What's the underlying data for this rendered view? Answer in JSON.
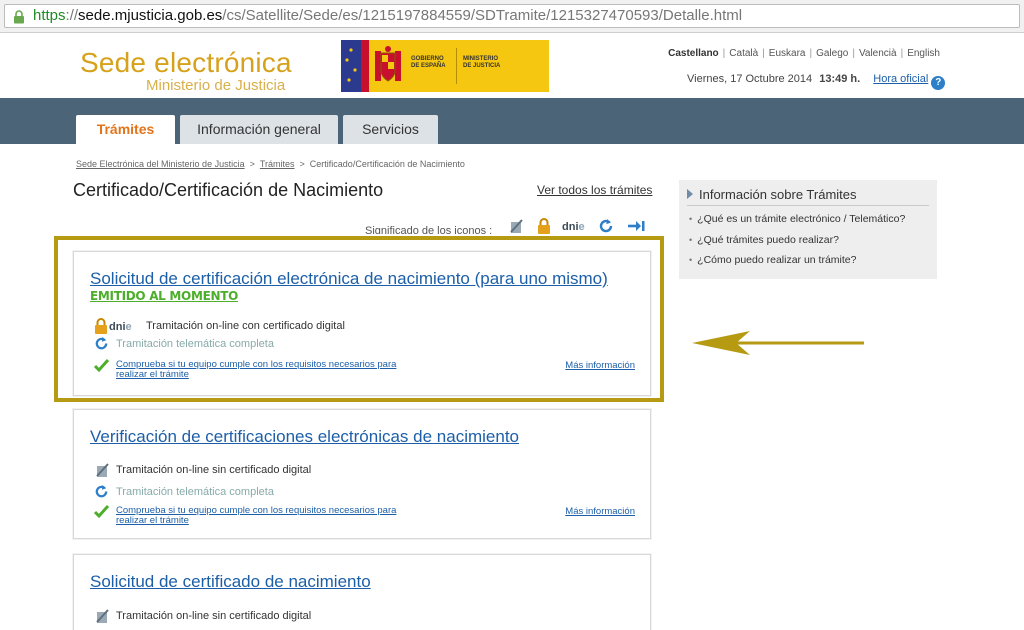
{
  "browser": {
    "url_scheme": "https",
    "url_sep": "://",
    "url_host": "sede.mjusticia.gob.es",
    "url_path": "/cs/Satellite/Sede/es/1215197884559/SDTramite/1215327470593/Detalle.html"
  },
  "header": {
    "brand_title": "Sede electrónica",
    "brand_subtitle": "Ministerio de Justicia",
    "gov_logo_text1": "GOBIERNO\nDE ESPAÑA",
    "gov_logo_text2": "MINISTERIO\nDE JUSTICIA",
    "languages": [
      "Castellano",
      "Català",
      "Euskara",
      "Galego",
      "Valencià",
      "English"
    ],
    "date": "Viernes, 17 Octubre 2014",
    "time": "13:49 h.",
    "hora_oficial": "Hora oficial",
    "help": "?"
  },
  "nav": {
    "tabs": [
      {
        "label": "Trámites"
      },
      {
        "label": "Información general"
      },
      {
        "label": "Servicios"
      }
    ]
  },
  "breadcrumb": {
    "items": [
      "Sede Electrónica del Ministerio de Justicia",
      "Trámites",
      "Certificado/Certificación de Nacimiento"
    ],
    "sep": ">"
  },
  "main": {
    "title": "Certificado/Certificación de Nacimiento",
    "see_all": "Ver todos los trámites",
    "icons_legend": "Significado de los iconos :",
    "cards": [
      {
        "title": "Solicitud de certificación electrónica de nacimiento (para uno mismo)",
        "badge": "EMITIDO AL MOMENTO",
        "online": "Tramitación on-line con certificado digital",
        "tele": "Tramitación telemática completa",
        "check_line1": "Comprueba si tu equipo cumple con los requisitos necesarios para",
        "check_line2": "realizar el trámite",
        "more": "Más información"
      },
      {
        "title": "Verificación de certificaciones electrónicas de nacimiento",
        "online": "Tramitación on-line sin certificado digital",
        "tele": "Tramitación telemática completa",
        "check_line1": "Comprueba si tu equipo cumple con los requisitos necesarios para",
        "check_line2": "realizar el trámite",
        "more": "Más información"
      },
      {
        "title": "Solicitud de certificado de nacimiento",
        "online": "Tramitación on-line sin certificado digital"
      }
    ]
  },
  "sidebar": {
    "title": "Información sobre Trámites",
    "items": [
      "¿Qué es un trámite electrónico / Telemático?",
      "¿Qué trámites puedo realizar?",
      "¿Cómo puedo realizar un trámite?"
    ]
  },
  "colors": {
    "brand": "#d7a21b",
    "nav_band": "#4b6478",
    "link": "#1c5fa8",
    "highlight": "#b59a12",
    "active_tab": "#e2741b",
    "emitido": "#4cae2a"
  },
  "annotation": {
    "icon": "arrow-left-icon"
  }
}
